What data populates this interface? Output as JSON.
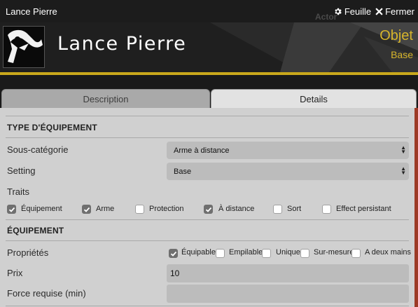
{
  "window": {
    "title": "Lance Pierre",
    "ghost_label": "Actor",
    "sheet_label": "Feuille",
    "close_label": "Fermer"
  },
  "header": {
    "item_name": "Lance Pierre",
    "item_type": "Objet",
    "item_subtype": "Base",
    "accent_color": "#d7b52b"
  },
  "tabs": [
    {
      "label": "Description",
      "active": false
    },
    {
      "label": "Details",
      "active": true
    }
  ],
  "details": {
    "section_type": "TYPE D'ÉQUIPEMENT",
    "subcategory": {
      "label": "Sous-catégorie",
      "value": "Arme à distance"
    },
    "setting": {
      "label": "Setting",
      "value": "Base"
    },
    "traits": {
      "label": "Traits",
      "items": [
        {
          "label": "Équipement",
          "checked": true
        },
        {
          "label": "Arme",
          "checked": true
        },
        {
          "label": "Protection",
          "checked": false
        },
        {
          "label": "À distance",
          "checked": true
        },
        {
          "label": "Sort",
          "checked": false
        },
        {
          "label": "Effect persistant",
          "checked": false
        }
      ]
    },
    "section_equip": "ÉQUIPEMENT",
    "properties": {
      "label": "Propriétés",
      "items": [
        {
          "label": "Équipable",
          "checked": true
        },
        {
          "label": "Empilable",
          "checked": false
        },
        {
          "label": "Unique",
          "checked": false
        },
        {
          "label": "Sur-mesure",
          "checked": false
        },
        {
          "label": "A deux mains",
          "checked": false
        }
      ]
    },
    "price": {
      "label": "Prix",
      "value": "10"
    },
    "strength": {
      "label": "Force requise (min)",
      "value": ""
    }
  }
}
